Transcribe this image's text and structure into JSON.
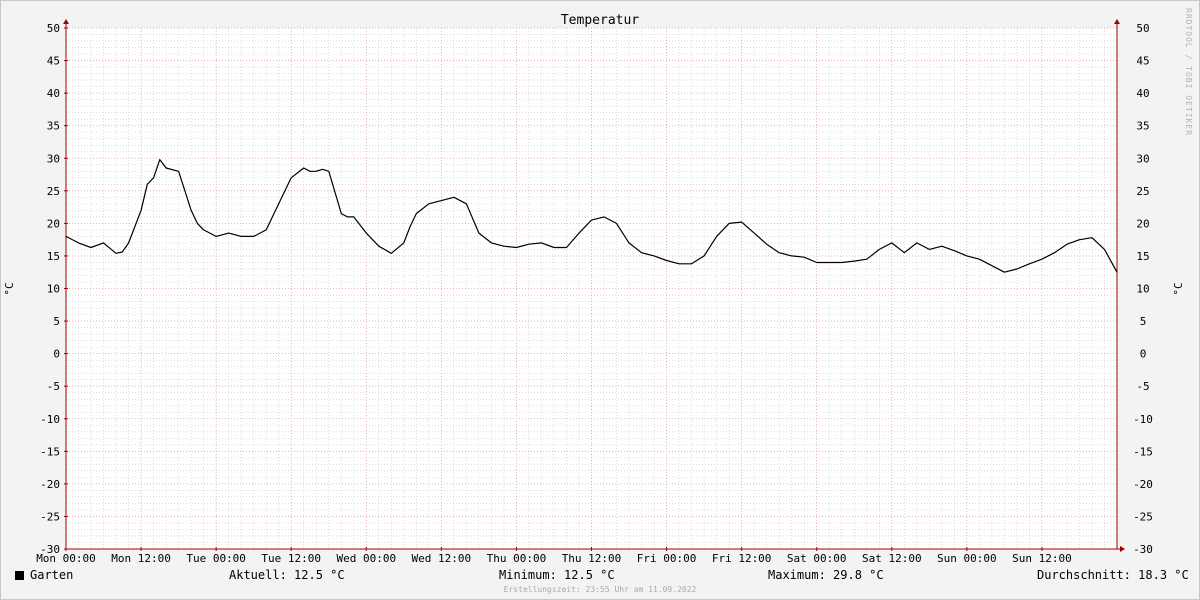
{
  "chart_data": {
    "type": "line",
    "title": "Temperatur",
    "ylabel": "°C",
    "ylim": [
      -30,
      50
    ],
    "y_ticks": [
      "50",
      "45",
      "40",
      "35",
      "30",
      "25",
      "20",
      "15",
      "10",
      "5",
      "0",
      "-5",
      "-10",
      "-15",
      "-20",
      "-25",
      "-30"
    ],
    "x_ticks": [
      "Mon 00:00",
      "Mon 12:00",
      "Tue 00:00",
      "Tue 12:00",
      "Wed 00:00",
      "Wed 12:00",
      "Thu 00:00",
      "Thu 12:00",
      "Fri 00:00",
      "Fri 12:00",
      "Sat 00:00",
      "Sat 12:00",
      "Sun 00:00",
      "Sun 12:00"
    ],
    "x_range_hours": [
      0,
      168
    ],
    "grid": true,
    "line_color": "#000000",
    "grid_major_color": "#e0a0a0",
    "grid_minor_color": "#c8c8c8",
    "axis_color": "#a00000",
    "series": [
      {
        "name": "Garten",
        "x_hours": [
          0,
          2,
          4,
          6,
          8,
          9,
          10,
          12,
          13,
          14,
          15,
          16,
          18,
          19,
          20,
          21,
          22,
          23,
          24,
          26,
          28,
          30,
          32,
          34,
          36,
          38,
          39,
          40,
          41,
          42,
          44,
          45,
          46,
          48,
          50,
          52,
          54,
          55,
          56,
          58,
          60,
          62,
          64,
          66,
          68,
          70,
          72,
          74,
          76,
          78,
          80,
          82,
          84,
          86,
          88,
          90,
          92,
          94,
          96,
          98,
          100,
          102,
          104,
          106,
          108,
          110,
          112,
          114,
          116,
          118,
          120,
          122,
          124,
          126,
          128,
          130,
          132,
          134,
          136,
          138,
          140,
          142,
          144,
          146,
          148,
          150,
          152,
          154,
          156,
          158,
          160,
          162,
          164,
          166,
          168
        ],
        "values": [
          18,
          17,
          16.3,
          17,
          15.4,
          15.6,
          17,
          22,
          26,
          27,
          29.8,
          28.5,
          28,
          25,
          22,
          20,
          19,
          18.5,
          18,
          18.5,
          18,
          18,
          19,
          23,
          27,
          28.5,
          28,
          28,
          28.3,
          28,
          21.5,
          21,
          21,
          18.5,
          16.5,
          15.4,
          17,
          19.5,
          21.5,
          23,
          23.5,
          24,
          23,
          18.5,
          17,
          16.5,
          16.3,
          16.8,
          17,
          16.3,
          16.3,
          18.5,
          20.5,
          21,
          20,
          17,
          15.5,
          15,
          14.3,
          13.8,
          13.8,
          15,
          18,
          20,
          20.2,
          18.5,
          16.8,
          15.5,
          15,
          14.8,
          14,
          14,
          14,
          14.2,
          14.5,
          16,
          17,
          15.5,
          17,
          16,
          16.5,
          15.8,
          15,
          14.5,
          13.5,
          12.5,
          13,
          13.8,
          14.5,
          15.5,
          16.8,
          17.5,
          17.8,
          16,
          12.5
        ]
      }
    ]
  },
  "legend": {
    "series_label": "Garten",
    "current": "Aktuell: 12.5 °C",
    "minimum": "Minimum: 12.5 °C",
    "maximum": "Maximum: 29.8 °C",
    "average": "Durchschnitt: 18.3 °C"
  },
  "footer": {
    "created": "Erstellungszeit: 23:55 Uhr am 11.09.2022",
    "watermark": "RRDTOOL / TOBI OETIKER"
  }
}
